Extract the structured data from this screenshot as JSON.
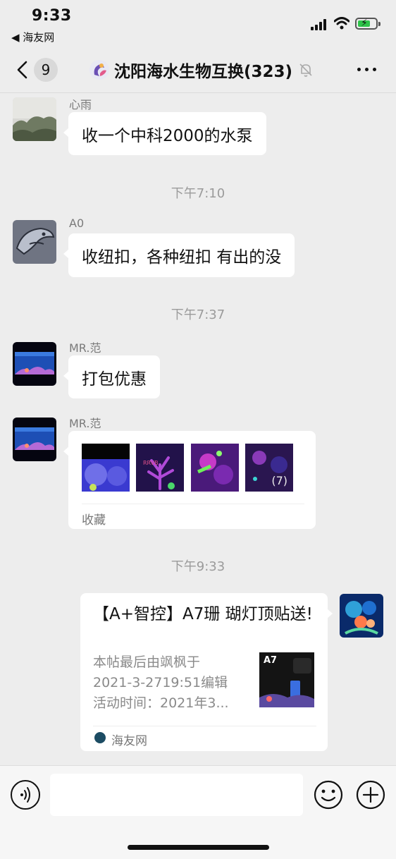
{
  "status_bar": {
    "time": "9:33",
    "back_app": "◀ 海友网"
  },
  "nav": {
    "unread_badge": "9",
    "title": "沈阳海水生物互换(323)"
  },
  "messages": [
    {
      "sender": "心雨",
      "text": "收一个中科2000的水泵"
    },
    {
      "timestamp": "下午7:10"
    },
    {
      "sender": "A0",
      "text": "收纽扣，各种纽扣 有出的没"
    },
    {
      "timestamp": "下午7:37"
    },
    {
      "sender": "MR.范",
      "text": "打包优惠"
    },
    {
      "sender": "MR.范",
      "favorites": {
        "more_count": "(7)",
        "label": "收藏"
      }
    },
    {
      "timestamp": "下午9:33"
    },
    {
      "link_card": {
        "title": "【A+智控】A7珊 瑚灯顶贴送!",
        "desc_lines": [
          "本帖最后由飒枫于",
          "2021-3-2719:51编辑",
          "活动时间：2021年3..."
        ],
        "thumb_label": "A7",
        "source": "海友网"
      }
    }
  ],
  "colors": {
    "background": "#ededed",
    "bubble": "#ffffff",
    "timestamp": "#9b9b9b",
    "battery": "#2fc44a"
  }
}
